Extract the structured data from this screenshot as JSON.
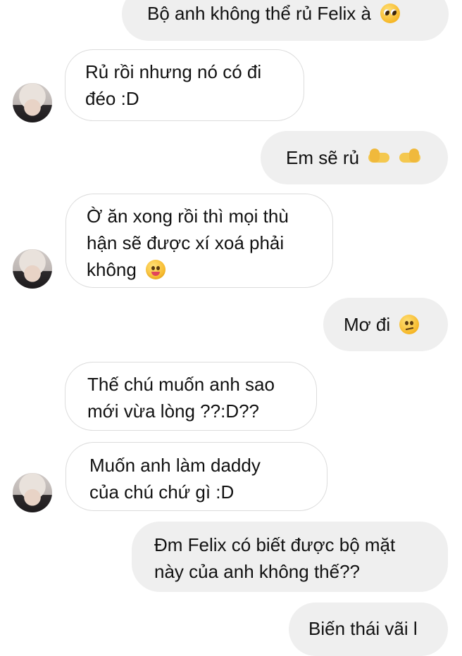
{
  "messages": [
    {
      "id": "m1",
      "side": "sent",
      "lines": [
        "Bộ anh không thể rủ Felix à"
      ],
      "emoji": "pleading-face-icon"
    },
    {
      "id": "m2",
      "side": "received",
      "lines": [
        "Rủ rồi nhưng nó có đi",
        "đéo :D"
      ]
    },
    {
      "id": "m3",
      "side": "sent",
      "lines": [
        "Em sẽ rủ"
      ],
      "emoji": "pointing-hands-icon"
    },
    {
      "id": "m4",
      "side": "received",
      "lines": [
        "Ờ ăn xong rồi thì mọi thù",
        "hận sẽ được xí xoá phải",
        "không"
      ],
      "emoji": "yum-face-icon"
    },
    {
      "id": "m5",
      "side": "sent",
      "lines": [
        "Mơ đi"
      ],
      "emoji": "smirk-face-icon"
    },
    {
      "id": "m6",
      "side": "received",
      "lines": [
        "Thế chú muốn anh sao",
        "mới vừa lòng ??:D??"
      ]
    },
    {
      "id": "m7",
      "side": "received",
      "lines": [
        "Muốn anh làm daddy",
        "của chú chứ gì :D"
      ]
    },
    {
      "id": "m8",
      "side": "sent",
      "lines": [
        "Đm Felix có biết được bộ mặt",
        "này của anh không thế??"
      ]
    },
    {
      "id": "m9",
      "side": "sent",
      "lines": [
        "Biến thái vãi l"
      ]
    }
  ]
}
